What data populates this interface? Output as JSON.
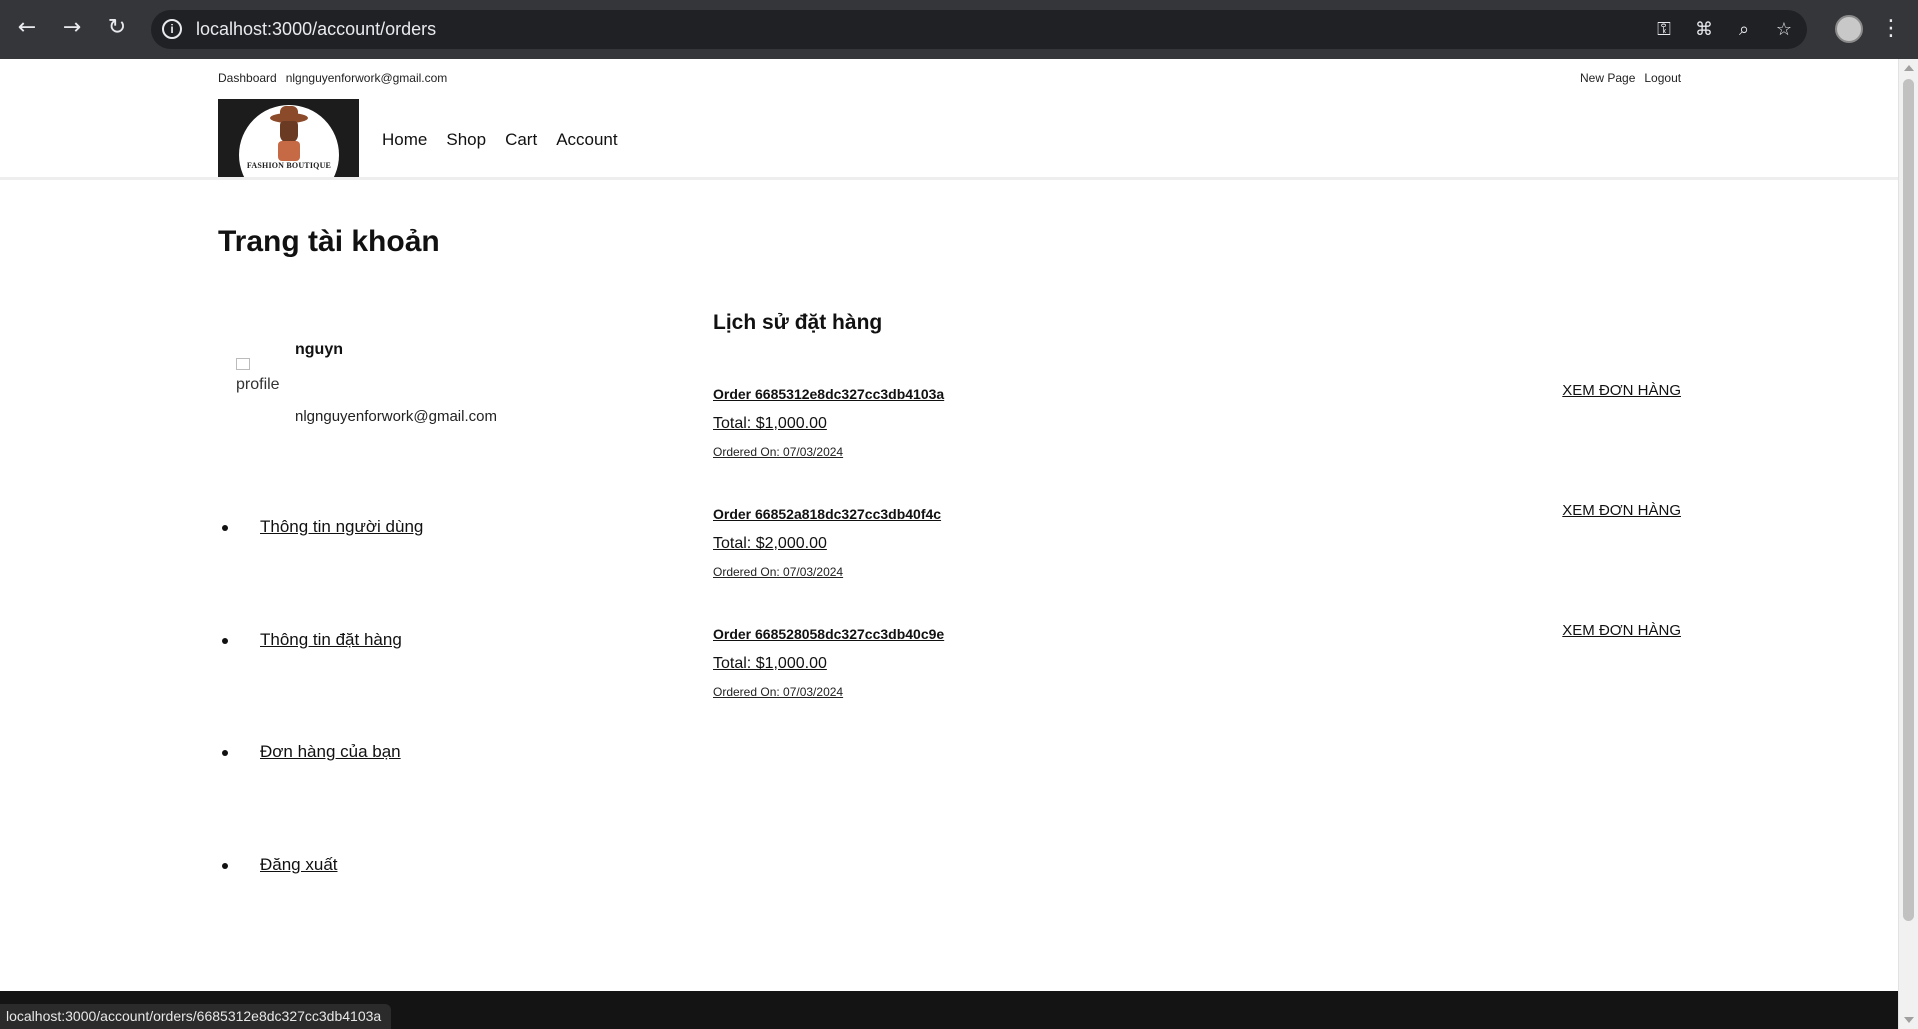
{
  "browser": {
    "url": "localhost:3000/account/orders",
    "status_url": "localhost:3000/account/orders/6685312e8dc327cc3db4103a",
    "back_icon": "back-arrow-icon",
    "forward_icon": "forward-arrow-icon",
    "reload_icon": "reload-icon"
  },
  "top_strip": {
    "dashboard": "Dashboard",
    "email": "nlgnguyenforwork@gmail.com",
    "new_page": "New Page",
    "logout": "Logout"
  },
  "logo": {
    "brand": "FASHION BOUTIQUE"
  },
  "nav": {
    "home": "Home",
    "shop": "Shop",
    "cart": "Cart",
    "account": "Account"
  },
  "page": {
    "title": "Trang tài khoản"
  },
  "profile": {
    "image_alt": "profile",
    "name": "nguyn",
    "email": "nlgnguyenforwork@gmail.com"
  },
  "side_menu": [
    {
      "label": "Thông tin người dùng"
    },
    {
      "label": "Thông tin đặt hàng"
    },
    {
      "label": "Đơn hàng của bạn"
    },
    {
      "label": "Đăng xuất"
    }
  ],
  "orders_section": {
    "title": "Lịch sử đặt hàng",
    "orders": [
      {
        "id": "Order 6685312e8dc327cc3db4103a",
        "total": "Total: $1,000.00",
        "date": "Ordered On: 07/03/2024",
        "action": "XEM ĐƠN HÀNG"
      },
      {
        "id": "Order 66852a818dc327cc3db40f4c",
        "total": "Total: $2,000.00",
        "date": "Ordered On: 07/03/2024",
        "action": "XEM ĐƠN HÀNG"
      },
      {
        "id": "Order 668528058dc327cc3db40c9e",
        "total": "Total: $1,000.00",
        "date": "Ordered On: 07/03/2024",
        "action": "XEM ĐƠN HÀNG"
      }
    ]
  }
}
